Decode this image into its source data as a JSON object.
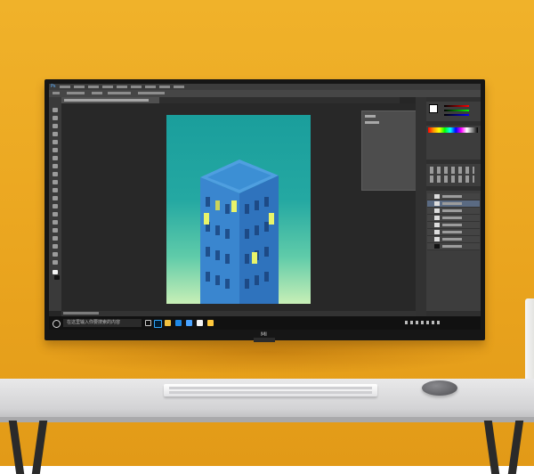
{
  "scene": {
    "description_colors": {
      "wall": "#eaa51f",
      "desk": "#dedee0",
      "monitor_bezel": "#161616",
      "artboard_top": "#1a9e9c",
      "artboard_bottom": "#c8efb6",
      "building": "#3f8fd6",
      "window_lit": "#e9f46a"
    },
    "brand_logo": "MI"
  },
  "photoshop": {
    "app_icon": "Ps",
    "canvas": {
      "building_windows_lit": 5
    }
  },
  "taskbar": {
    "search_placeholder": "在这里输入你要搜索的内容",
    "icons": [
      "start-icon",
      "task-view-icon",
      "photoshop-icon",
      "explorer-icon",
      "edge-icon",
      "mail-icon",
      "store-icon",
      "folder-icon"
    ]
  }
}
